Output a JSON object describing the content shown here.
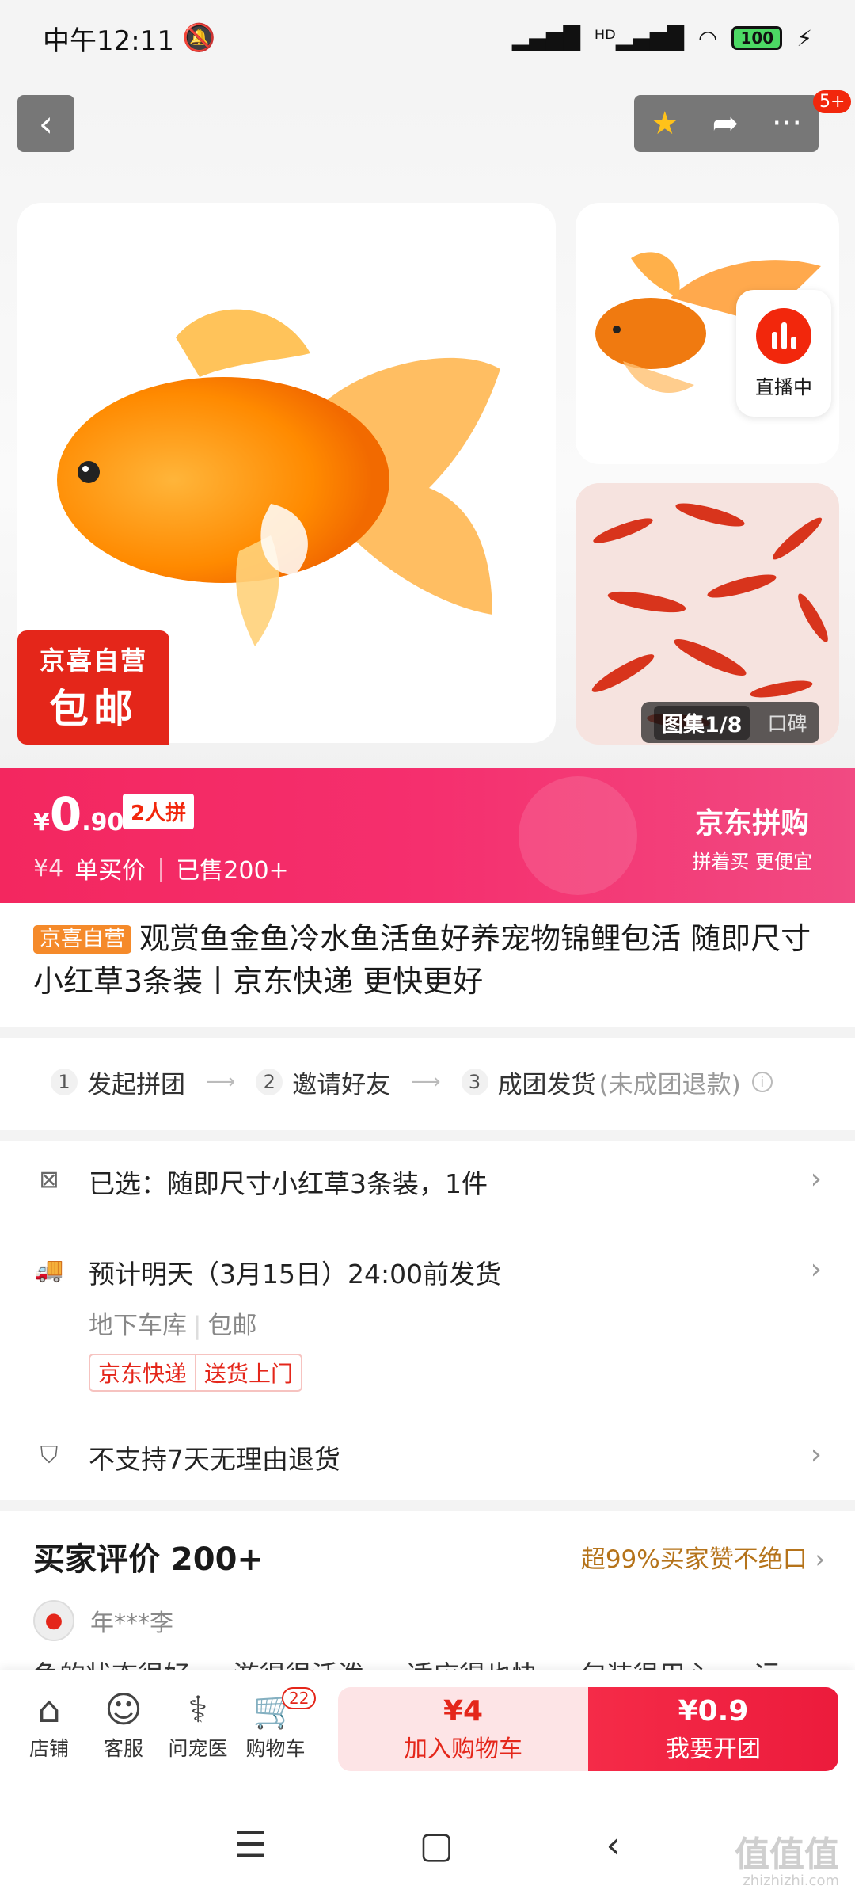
{
  "status": {
    "time": "中午12:11",
    "battery": "100"
  },
  "header": {
    "more_badge": "5+"
  },
  "gallery": {
    "self_badge_line1": "京喜自营",
    "self_badge_line2": "包邮",
    "live_label": "直播中",
    "album_label": "图集1/8",
    "reviews_label": "口碑"
  },
  "price": {
    "currency": "¥",
    "integer": "0",
    "decimal": ".90",
    "group_tag": "2人拼",
    "single_price": "¥4",
    "single_label": "单买价",
    "sold": "已售200+",
    "brand": "京东拼购",
    "slogan": "拼着买 更便宜"
  },
  "product": {
    "tag": "京喜自营",
    "title": "观赏鱼金鱼冷水鱼活鱼好养宠物锦鲤包活 随即尺寸小红草3条装丨京东快递 更快更好"
  },
  "steps": {
    "s1_num": "1",
    "s1": "发起拼团",
    "s2_num": "2",
    "s2": "邀请好友",
    "s3_num": "3",
    "s3": "成团发货",
    "s3_note": "(未成团退款)"
  },
  "selection": {
    "text": "已选：随即尺寸小红草3条装，1件"
  },
  "delivery": {
    "text": "预计明天（3月15日）24:00前发货",
    "from": "地下车库",
    "shipping": "包邮",
    "tag1": "京东快递",
    "tag2": "送货上门"
  },
  "returns": {
    "text": "不支持7天无理由退货"
  },
  "reviews": {
    "title": "买家评价 200+",
    "praise": "超99%买家赞不绝口",
    "user": "年***李",
    "tags": [
      "鱼的状态很好",
      "游得很活泼",
      "适应得也快",
      "包装很用心",
      "运"
    ]
  },
  "actionbar": {
    "shop": "店铺",
    "service": "客服",
    "vet": "问宠医",
    "cart": "购物车",
    "cart_count": "22",
    "add_cart_price": "¥4",
    "add_cart_label": "加入购物车",
    "group_price": "¥0.9",
    "group_label": "我要开团"
  },
  "watermark": {
    "text": "值值值",
    "domain": "zhizhizhi.com"
  },
  "colors": {
    "accent": "#f2270c",
    "price_band": "#f3275f",
    "praise": "#b5731a"
  }
}
